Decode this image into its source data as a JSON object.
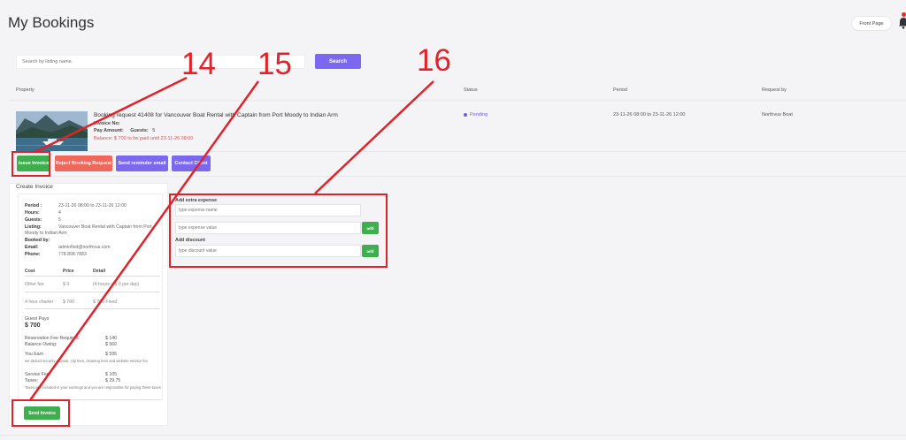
{
  "header": {
    "title": "My Bookings",
    "front_page_label": "Front Page",
    "bell_icon": "bell-icon",
    "notification_color": "#e03131"
  },
  "search": {
    "placeholder": "Search by listing name.",
    "button_label": "Search"
  },
  "table": {
    "columns": [
      "Property",
      "Status",
      "Period",
      "Request by"
    ]
  },
  "booking": {
    "title": "Booking request 41408 for Vancouver Boat Rental with Captain from Port Moody to Indian Arm",
    "invoice_no_label": "Invoice No:",
    "pay_amount_label": "Pay Amount:",
    "guests_label": "Guests:",
    "guests_value": "5",
    "balance_text": "Balance: $ 700 to be paid until 23-11-26 08:00",
    "status": "Pending",
    "period": "23-11-26 08:00 to 23-11-26 12:00",
    "requested_by": "Northvus Boat"
  },
  "actions": {
    "issue_invoice": "Issue Invoice",
    "reject_request": "Reject Booking Request",
    "send_reminder": "Send reminder email",
    "contact_client": "Contact Client"
  },
  "invoice": {
    "section_title": "Create Invoice",
    "details": [
      {
        "key": "Period :",
        "value": "23-11-26 08:00 to 23-11-26 12:00"
      },
      {
        "key": "Hours:",
        "value": "4"
      },
      {
        "key": "Guests:",
        "value": "5"
      },
      {
        "key": "Listing:",
        "value": "Vancouver Boat Rental with Captain from Port"
      },
      {
        "key": "Booked by:",
        "value": ""
      },
      {
        "key": "Email:",
        "value": "adminfwd@northvus.com"
      },
      {
        "key": "Phone:",
        "value": "778.898.7883"
      }
    ],
    "listing_continued": "Moody to Indian Arm",
    "cost_headers": [
      "Cost",
      "Price",
      "Detail"
    ],
    "cost_rows": [
      {
        "cost": "Other fee",
        "price": "$ 0",
        "detail": "(4 hours x $ 0 per day)"
      },
      {
        "cost": "4 hour charter",
        "price": "$ 700",
        "detail": "$ 700 Fixed"
      }
    ],
    "guest_pays_label": "Guest Pays",
    "guest_pays_value": "$ 700",
    "summary": [
      {
        "key": "Reservation Fee Required:",
        "value": "$ 140"
      },
      {
        "key": "Balance Owing:",
        "value": "$ 560"
      },
      {
        "key": "You Earn",
        "value": "$ 595"
      }
    ],
    "earn_note": "we deduct security deposit, city fees, cleaning fees and website service fee",
    "summary2": [
      {
        "key": "Service Fee:",
        "value": "$ 105"
      },
      {
        "key": "Taxes:",
        "value": "$ 29.75"
      }
    ],
    "tax_note": "Taxes are included in your earnings and you are responsible for paying these taxes",
    "send_invoice": "Send Invoice"
  },
  "extras": {
    "expense_label": "Add extra expense",
    "expense_name_placeholder": "type expense name",
    "expense_value_placeholder": "type expense value",
    "discount_label": "Add discount",
    "discount_placeholder": "type discount value",
    "add_label": "add"
  },
  "annotations": [
    "14",
    "15",
    "16"
  ],
  "colors": {
    "accent": "#7b68ee",
    "green": "#3fae4f",
    "red_button": "#f0685c",
    "annotation": "#e0232a"
  }
}
